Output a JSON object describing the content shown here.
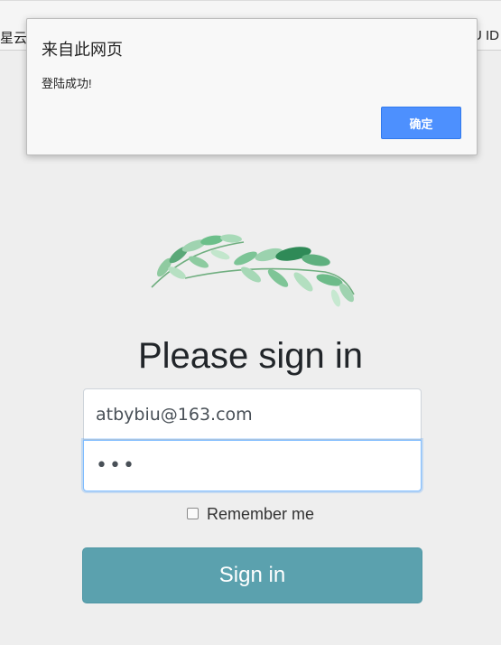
{
  "browser": {
    "bookmark_left": "星云",
    "bookmark_right": "U ID"
  },
  "dialog": {
    "title": "来自此网页",
    "message": "登陆成功!",
    "ok_label": "确定"
  },
  "page": {
    "logo": "leaf-branch-icon",
    "heading": "Please sign in",
    "email_value": "atbybiu@163.com",
    "password_value": "•••",
    "remember_label": "Remember me",
    "remember_checked": false,
    "signin_label": "Sign in"
  },
  "colors": {
    "background": "#eeeeee",
    "button": "#5ba1ae",
    "dialog_button": "#4d90fe",
    "leaf_dark": "#2e8b57",
    "leaf_light": "#9ed4b0"
  }
}
